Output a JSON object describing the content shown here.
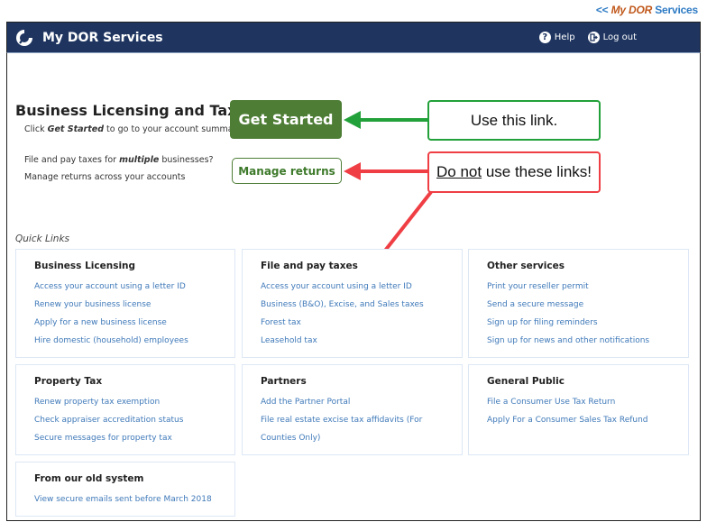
{
  "top_link": {
    "prefix": "<<",
    "part1": "My DOR",
    "part2": "Services"
  },
  "navbar": {
    "brand": "My DOR Services",
    "help_label": "Help",
    "logout_label": "Log out",
    "help_icon": "question-circle-icon",
    "logout_icon": "logout-icon",
    "logo_icon": "dor-logo-icon"
  },
  "hero": {
    "title": "Business Licensing and Tax",
    "sub_prefix": "Click ",
    "sub_bold": "Get Started",
    "sub_suffix": " to go to your account summary",
    "multi_prefix": "File and pay taxes for ",
    "multi_bold": "multiple",
    "multi_suffix": " businesses?",
    "multi_line2": "Manage returns across your accounts",
    "get_started_label": "Get Started",
    "manage_returns_label": "Manage returns"
  },
  "annotations": {
    "green_callout": "Use this link.",
    "red_callout_underlined": "Do not",
    "red_callout_rest": " use these links!",
    "colors": {
      "green": "#22a13a",
      "red": "#ef3e44"
    }
  },
  "quick_links": {
    "label": "Quick Links",
    "cards": [
      {
        "title": "Business Licensing",
        "links": [
          "Access your account using a letter ID",
          "Renew your business license",
          "Apply for a new business license",
          "Hire domestic (household) employees"
        ]
      },
      {
        "title": "File and pay taxes",
        "links": [
          "Access your account using a letter ID",
          "Business (B&O), Excise, and Sales taxes",
          "Forest tax",
          "Leasehold tax"
        ]
      },
      {
        "title": "Other services",
        "links": [
          "Print your reseller permit",
          "Send a secure message",
          "Sign up for filing reminders",
          "Sign up for news and other notifications"
        ]
      },
      {
        "title": "Property Tax",
        "links": [
          "Renew property tax exemption",
          "Check appraiser accreditation status",
          "Secure messages for property tax"
        ]
      },
      {
        "title": "Partners",
        "links": [
          "Add the Partner Portal",
          "File real estate excise tax affidavits (For Counties Only)"
        ]
      },
      {
        "title": "General Public",
        "links": [
          "File a Consumer Use Tax Return",
          "Apply For a Consumer Sales Tax Refund"
        ]
      },
      {
        "title": "From our old system",
        "links": [
          "View secure emails sent before March 2018"
        ]
      }
    ]
  },
  "colors": {
    "navbar_bg": "#1f3560",
    "primary_button": "#4e7d36",
    "link": "#3f79b9",
    "card_border": "#dde7f5"
  }
}
